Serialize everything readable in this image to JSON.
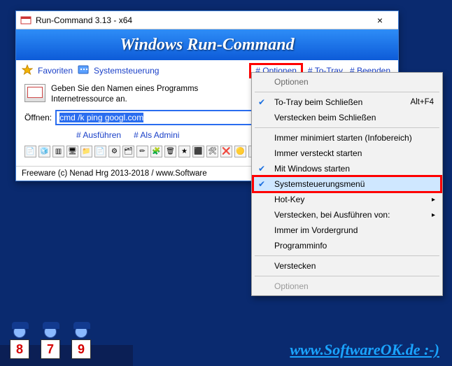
{
  "window": {
    "title": "Run-Command 3.13 - x64",
    "banner": "Windows Run-Command",
    "close_label": "×"
  },
  "linkbar": {
    "favoriten": "Favoriten",
    "systemsteuerung": "Systemsteuerung",
    "optionen": "# Optionen",
    "to_tray": "# To-Tray",
    "beenden": "# Beenden"
  },
  "body": {
    "prompt_line1": "Geben Sie den Namen eines Programms",
    "prompt_line2": "Internetressource an.",
    "open_label": "Öffnen:",
    "open_value": "cmd /k ping googl.com",
    "ausfuehren": "# Ausführen",
    "als_admin": "# Als Admini"
  },
  "footer": {
    "text": "Freeware (c) Nenad Hrg 2013-2018 / www.Software"
  },
  "menu": {
    "header": "Optionen",
    "items": [
      {
        "label": "To-Tray beim Schließen",
        "checked": true,
        "accel": "Alt+F4"
      },
      {
        "label": "Verstecken beim Schließen"
      }
    ],
    "items2": [
      {
        "label": "Immer minimiert starten (Infobereich)"
      },
      {
        "label": "Immer versteckt starten"
      },
      {
        "label": "Mit Windows starten",
        "checked": true
      },
      {
        "label": "Systemsteuerungsmenü",
        "checked": true,
        "hilite": true
      },
      {
        "label": "Hot-Key",
        "sub": true
      },
      {
        "label": "Verstecken, bei Ausführen von:",
        "sub": true
      },
      {
        "label": "Immer im Vordergrund"
      },
      {
        "label": "Programminfo"
      }
    ],
    "items3": [
      {
        "label": "Verstecken"
      }
    ],
    "footer": "Optionen"
  },
  "judges": [
    "8",
    "7",
    "9"
  ],
  "site": "www.SoftwareOK.de :-)"
}
